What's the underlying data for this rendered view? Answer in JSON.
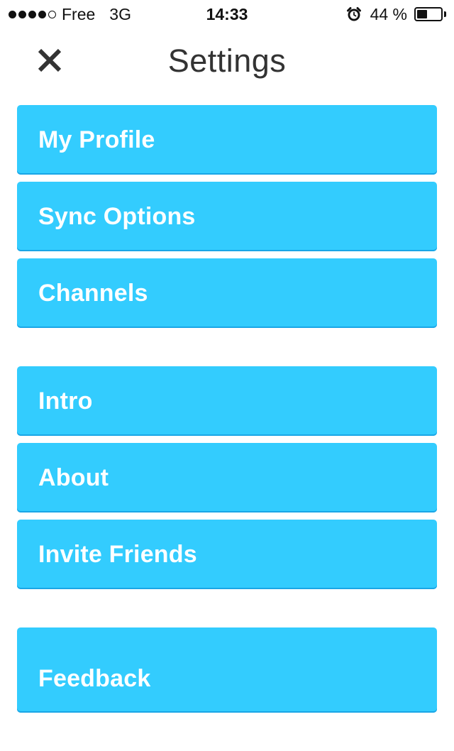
{
  "status_bar": {
    "carrier": "Free",
    "network": "3G",
    "time": "14:33",
    "battery_percent_label": "44 %",
    "battery_level": 0.44,
    "signal_strength": 4,
    "signal_max": 5,
    "icons": {
      "alarm": "alarm-clock-icon",
      "battery": "battery-icon",
      "signal": "signal-strength-icon"
    }
  },
  "header": {
    "title": "Settings",
    "close_icon": "close-x-icon"
  },
  "menu": {
    "groups": [
      {
        "items": [
          {
            "label": "My Profile"
          },
          {
            "label": "Sync Options"
          },
          {
            "label": "Channels"
          }
        ]
      },
      {
        "items": [
          {
            "label": "Intro"
          },
          {
            "label": "About"
          },
          {
            "label": "Invite Friends"
          }
        ]
      },
      {
        "items": [
          {
            "label": "Feedback"
          }
        ]
      }
    ]
  },
  "colors": {
    "accent": "#33ccfe",
    "accent_edge": "#1aa6e6",
    "title_text": "#333333",
    "item_text": "#ffffff",
    "background": "#ffffff"
  }
}
